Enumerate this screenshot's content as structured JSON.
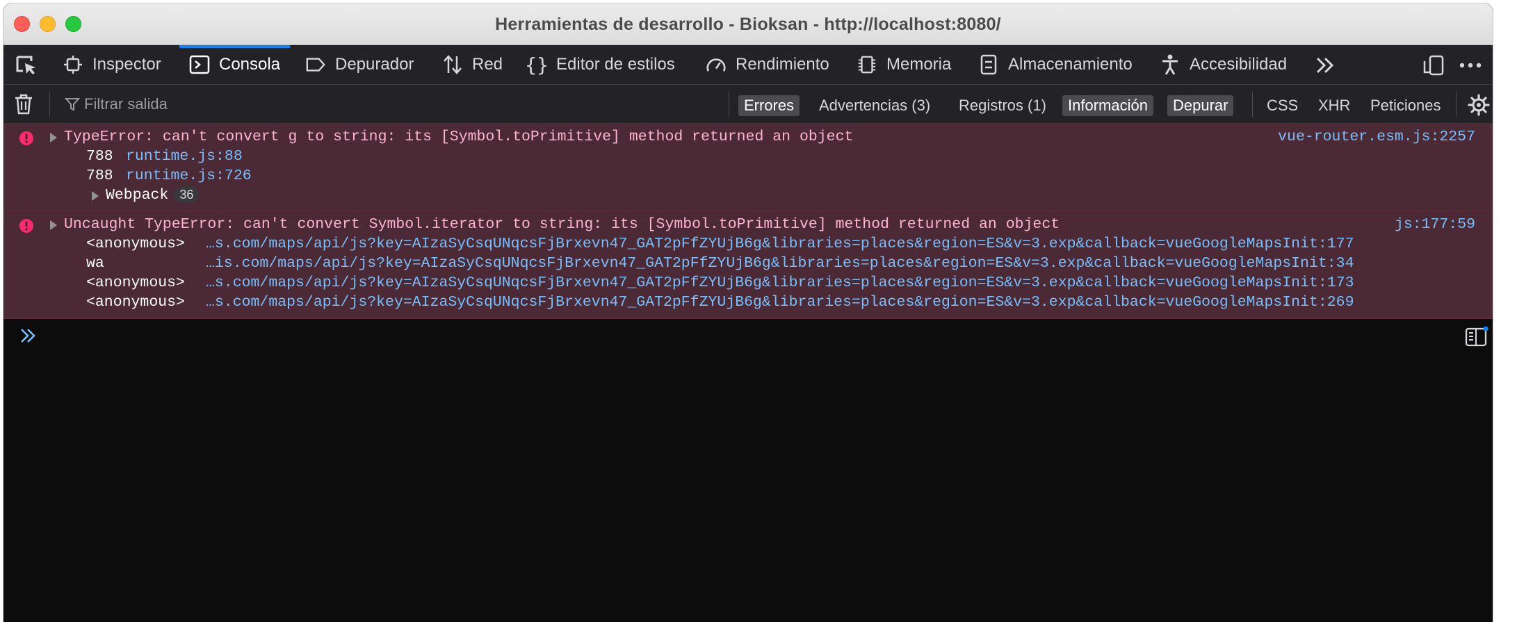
{
  "window": {
    "title": "Herramientas de desarrollo - Bioksan - http://localhost:8080/"
  },
  "toolbar": {
    "tabs": [
      {
        "label": "Inspector",
        "icon": "inspector-icon"
      },
      {
        "label": "Consola",
        "icon": "console-icon",
        "selected": true
      },
      {
        "label": "Depurador",
        "icon": "debugger-icon"
      },
      {
        "label": "Red",
        "icon": "network-icon"
      },
      {
        "label": "Editor de estilos",
        "icon": "braces-icon"
      },
      {
        "label": "Rendimiento",
        "icon": "gauge-icon"
      },
      {
        "label": "Memoria",
        "icon": "memory-icon"
      },
      {
        "label": "Almacenamiento",
        "icon": "storage-icon"
      },
      {
        "label": "Accesibilidad",
        "icon": "accessibility-icon"
      }
    ]
  },
  "filterbar": {
    "placeholder": "Filtrar salida",
    "filters": [
      {
        "label": "Errores",
        "active": true
      },
      {
        "label": "Advertencias (3)",
        "active": false
      },
      {
        "label": "Registros (1)",
        "active": false
      },
      {
        "label": "Información",
        "active": true
      },
      {
        "label": "Depurar",
        "active": true
      }
    ],
    "request_filters": [
      "CSS",
      "XHR",
      "Peticiones"
    ]
  },
  "messages": [
    {
      "text": "TypeError: can't convert g to string: its [Symbol.toPrimitive] method returned an object",
      "location": "vue-router.esm.js:2257",
      "frames": [
        {
          "fn": "788",
          "src": "runtime.js:88"
        },
        {
          "fn": "788",
          "src": "runtime.js:726"
        }
      ],
      "group": {
        "label": "Webpack",
        "count": "36"
      }
    },
    {
      "text": "Uncaught TypeError: can't convert Symbol.iterator to string: its [Symbol.toPrimitive] method returned an object",
      "location": "js:177:59",
      "frames": [
        {
          "fn": "<anonymous>",
          "src": "…s.com/maps/api/js?key=AIzaSyCsqUNqcsFjBrxevn47_GAT2pFfZYUjB6g&libraries=places&region=ES&v=3.exp&callback=vueGoogleMapsInit:177"
        },
        {
          "fn": "wa",
          "src": "…is.com/maps/api/js?key=AIzaSyCsqUNqcsFjBrxevn47_GAT2pFfZYUjB6g&libraries=places&region=ES&v=3.exp&callback=vueGoogleMapsInit:34"
        },
        {
          "fn": "<anonymous>",
          "src": "…s.com/maps/api/js?key=AIzaSyCsqUNqcsFjBrxevn47_GAT2pFfZYUjB6g&libraries=places&region=ES&v=3.exp&callback=vueGoogleMapsInit:173"
        },
        {
          "fn": "<anonymous>",
          "src": "…s.com/maps/api/js?key=AIzaSyCsqUNqcsFjBrxevn47_GAT2pFfZYUjB6g&libraries=places&region=ES&v=3.exp&callback=vueGoogleMapsInit:269"
        }
      ]
    }
  ],
  "colors": {
    "accent": "#0a84ff",
    "error_bg": "#4b2a35",
    "error_text": "#ffb3d2",
    "link": "#75bfff",
    "error_icon": "#ff2a6d"
  }
}
